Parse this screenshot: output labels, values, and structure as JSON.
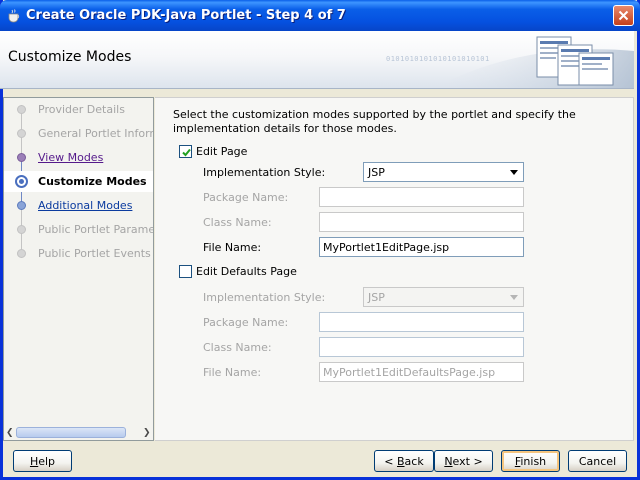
{
  "window": {
    "title": "Create Oracle PDK-Java Portlet - Step 4 of 7",
    "accent": "#0a5fe8"
  },
  "header": {
    "title": "Customize Modes",
    "binary_text": "0101010101010101010101"
  },
  "nav": {
    "items": [
      {
        "label": "Provider Details",
        "state": "disabled"
      },
      {
        "label": "General Portlet Informat",
        "state": "disabled"
      },
      {
        "label": "View Modes",
        "state": "visited"
      },
      {
        "label": "Customize Modes",
        "state": "active"
      },
      {
        "label": "Additional Modes",
        "state": "link"
      },
      {
        "label": "Public Portlet Parameter",
        "state": "disabled"
      },
      {
        "label": "Public Portlet Events",
        "state": "disabled"
      }
    ]
  },
  "main": {
    "description": "Select the customization modes supported by the portlet and specify the implementation details for those modes.",
    "edit_page": {
      "label": "Edit Page",
      "checked": true,
      "impl_style_label": "Implementation Style:",
      "impl_style_value": "JSP",
      "package_label": "Package Name:",
      "package_value": "",
      "class_label": "Class Name:",
      "class_value": "",
      "file_label": "File Name:",
      "file_value": "MyPortlet1EditPage.jsp"
    },
    "edit_defaults": {
      "label": "Edit Defaults Page",
      "checked": false,
      "impl_style_label": "Implementation Style:",
      "impl_style_value": "JSP",
      "package_label": "Package Name:",
      "package_value": "",
      "class_label": "Class Name:",
      "class_value": "",
      "file_label": "File Name:",
      "file_value": "MyPortlet1EditDefaultsPage.jsp"
    }
  },
  "buttons": {
    "help": {
      "before": "",
      "mnemonic": "H",
      "after": "elp"
    },
    "back": {
      "before": "< ",
      "mnemonic": "B",
      "after": "ack"
    },
    "next": {
      "before": "",
      "mnemonic": "N",
      "after": "ext >"
    },
    "finish": {
      "before": "",
      "mnemonic": "F",
      "after": "inish"
    },
    "cancel": {
      "before": "Cancel",
      "mnemonic": "",
      "after": ""
    }
  }
}
